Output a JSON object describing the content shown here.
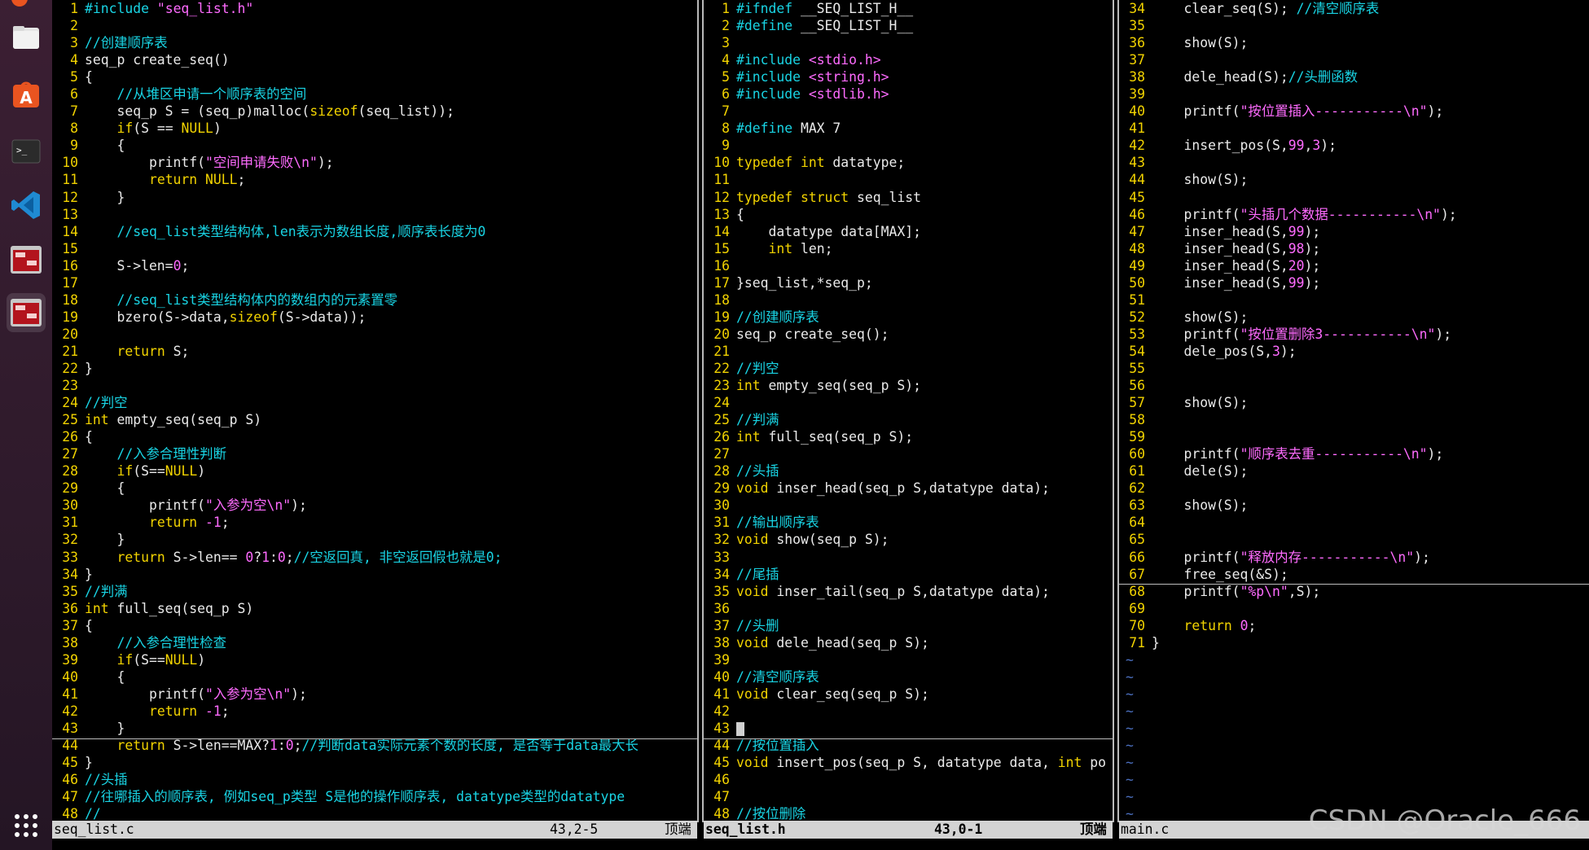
{
  "dock": {
    "items": [
      {
        "icon": "files-icon"
      },
      {
        "icon": "app-center-icon"
      },
      {
        "icon": "terminal-icon"
      },
      {
        "icon": "vscode-icon"
      },
      {
        "icon": "terminal-window-icon"
      },
      {
        "icon": "terminal-window-icon-active"
      }
    ],
    "apps_grid_icon": "apps-grid-icon"
  },
  "colors": {
    "comment": "#19d4e4",
    "keyword": "#f2d300",
    "string": "#ff6bff",
    "line_number": "#f2d300",
    "cursor_line": "#c8c8c8"
  },
  "panes": [
    {
      "file": "seq_list.c",
      "position": "43,2-5",
      "scroll": "顶端",
      "lines": [
        {
          "n": "1",
          "t": "#include \"seq_list.h\""
        },
        {
          "n": "2",
          "t": ""
        },
        {
          "n": "3",
          "t": "//创建顺序表"
        },
        {
          "n": "4",
          "t": "seq_p create_seq()"
        },
        {
          "n": "5",
          "t": "{"
        },
        {
          "n": "6",
          "t": "    //从堆区申请一个顺序表的空间"
        },
        {
          "n": "7",
          "t": "    seq_p S = (seq_p)malloc(sizeof(seq_list));"
        },
        {
          "n": "8",
          "t": "    if(S == NULL)"
        },
        {
          "n": "9",
          "t": "    {"
        },
        {
          "n": "10",
          "t": "        printf(\"空间申请失败\\n\");"
        },
        {
          "n": "11",
          "t": "        return NULL;"
        },
        {
          "n": "12",
          "t": "    }"
        },
        {
          "n": "13",
          "t": ""
        },
        {
          "n": "14",
          "t": "    //seq_list类型结构体,len表示为数组长度,顺序表长度为0"
        },
        {
          "n": "15",
          "t": ""
        },
        {
          "n": "16",
          "t": "    S->len=0;"
        },
        {
          "n": "17",
          "t": ""
        },
        {
          "n": "18",
          "t": "    //seq_list类型结构体内的数组内的元素置零"
        },
        {
          "n": "19",
          "t": "    bzero(S->data,sizeof(S->data));"
        },
        {
          "n": "20",
          "t": ""
        },
        {
          "n": "21",
          "t": "    return S;"
        },
        {
          "n": "22",
          "t": "}"
        },
        {
          "n": "23",
          "t": ""
        },
        {
          "n": "24",
          "t": "//判空"
        },
        {
          "n": "25",
          "t": "int empty_seq(seq_p S)"
        },
        {
          "n": "26",
          "t": "{"
        },
        {
          "n": "27",
          "t": "    //入参合理性判断"
        },
        {
          "n": "28",
          "t": "    if(S==NULL)"
        },
        {
          "n": "29",
          "t": "    {"
        },
        {
          "n": "30",
          "t": "        printf(\"入参为空\\n\");"
        },
        {
          "n": "31",
          "t": "        return -1;"
        },
        {
          "n": "32",
          "t": "    }"
        },
        {
          "n": "33",
          "t": "    return S->len== 0?1:0;//空返回真, 非空返回假也就是0;"
        },
        {
          "n": "34",
          "t": "}"
        },
        {
          "n": "35",
          "t": "//判满"
        },
        {
          "n": "36",
          "t": "int full_seq(seq_p S)"
        },
        {
          "n": "37",
          "t": "{"
        },
        {
          "n": "38",
          "t": "    //入参合理性检查"
        },
        {
          "n": "39",
          "t": "    if(S==NULL)"
        },
        {
          "n": "40",
          "t": "    {"
        },
        {
          "n": "41",
          "t": "        printf(\"入参为空\\n\");"
        },
        {
          "n": "42",
          "t": "        return -1;"
        },
        {
          "n": "43",
          "t": "    }"
        },
        {
          "n": "44",
          "t": "    return S->len==MAX?1:0;//判断data实际元素个数的长度, 是否等于data最大长"
        },
        {
          "n": "45",
          "t": "}"
        },
        {
          "n": "46",
          "t": "//头插"
        },
        {
          "n": "47",
          "t": "//往哪插入的顺序表, 例如seq_p类型 S是他的操作顺序表, datatype类型的datatype"
        },
        {
          "n": "48",
          "t": "//"
        }
      ]
    },
    {
      "file": "seq_list.h",
      "position": "43,0-1",
      "scroll": "顶端",
      "lines": [
        {
          "n": "1",
          "t": "#ifndef __SEQ_LIST_H__"
        },
        {
          "n": "2",
          "t": "#define __SEQ_LIST_H__"
        },
        {
          "n": "3",
          "t": ""
        },
        {
          "n": "4",
          "t": "#include <stdio.h>"
        },
        {
          "n": "5",
          "t": "#include <string.h>"
        },
        {
          "n": "6",
          "t": "#include <stdlib.h>"
        },
        {
          "n": "7",
          "t": ""
        },
        {
          "n": "8",
          "t": "#define MAX 7"
        },
        {
          "n": "9",
          "t": ""
        },
        {
          "n": "10",
          "t": "typedef int datatype;"
        },
        {
          "n": "11",
          "t": ""
        },
        {
          "n": "12",
          "t": "typedef struct seq_list"
        },
        {
          "n": "13",
          "t": "{"
        },
        {
          "n": "14",
          "t": "    datatype data[MAX];"
        },
        {
          "n": "15",
          "t": "    int len;"
        },
        {
          "n": "16",
          "t": ""
        },
        {
          "n": "17",
          "t": "}seq_list,*seq_p;"
        },
        {
          "n": "18",
          "t": ""
        },
        {
          "n": "19",
          "t": "//创建顺序表"
        },
        {
          "n": "20",
          "t": "seq_p create_seq();"
        },
        {
          "n": "21",
          "t": ""
        },
        {
          "n": "22",
          "t": "//判空"
        },
        {
          "n": "23",
          "t": "int empty_seq(seq_p S);"
        },
        {
          "n": "24",
          "t": ""
        },
        {
          "n": "25",
          "t": "//判满"
        },
        {
          "n": "26",
          "t": "int full_seq(seq_p S);"
        },
        {
          "n": "27",
          "t": ""
        },
        {
          "n": "28",
          "t": "//头插"
        },
        {
          "n": "29",
          "t": "void inser_head(seq_p S,datatype data);"
        },
        {
          "n": "30",
          "t": ""
        },
        {
          "n": "31",
          "t": "//输出顺序表"
        },
        {
          "n": "32",
          "t": "void show(seq_p S);"
        },
        {
          "n": "33",
          "t": ""
        },
        {
          "n": "34",
          "t": "//尾插"
        },
        {
          "n": "35",
          "t": "void inser_tail(seq_p S,datatype data);"
        },
        {
          "n": "36",
          "t": ""
        },
        {
          "n": "37",
          "t": "//头删"
        },
        {
          "n": "38",
          "t": "void dele_head(seq_p S);"
        },
        {
          "n": "39",
          "t": ""
        },
        {
          "n": "40",
          "t": "//清空顺序表"
        },
        {
          "n": "41",
          "t": "void clear_seq(seq_p S);"
        },
        {
          "n": "42",
          "t": ""
        },
        {
          "n": "43",
          "t": ""
        },
        {
          "n": "44",
          "t": "//按位置插入"
        },
        {
          "n": "45",
          "t": "void insert_pos(seq_p S, datatype data, int po"
        },
        {
          "n": "46",
          "t": ""
        },
        {
          "n": "47",
          "t": ""
        },
        {
          "n": "48",
          "t": "//按位删除"
        }
      ]
    },
    {
      "file": "main.c",
      "position": "",
      "scroll": "",
      "lines": [
        {
          "n": "34",
          "t": "    clear_seq(S); //清空顺序表"
        },
        {
          "n": "35",
          "t": ""
        },
        {
          "n": "36",
          "t": "    show(S);"
        },
        {
          "n": "37",
          "t": ""
        },
        {
          "n": "38",
          "t": "    dele_head(S);//头删函数"
        },
        {
          "n": "39",
          "t": ""
        },
        {
          "n": "40",
          "t": "    printf(\"按位置插入-----------\\n\");"
        },
        {
          "n": "41",
          "t": ""
        },
        {
          "n": "42",
          "t": "    insert_pos(S,99,3);"
        },
        {
          "n": "43",
          "t": ""
        },
        {
          "n": "44",
          "t": "    show(S);"
        },
        {
          "n": "45",
          "t": ""
        },
        {
          "n": "46",
          "t": "    printf(\"头插几个数据-----------\\n\");"
        },
        {
          "n": "47",
          "t": "    inser_head(S,99);"
        },
        {
          "n": "48",
          "t": "    inser_head(S,98);"
        },
        {
          "n": "49",
          "t": "    inser_head(S,20);"
        },
        {
          "n": "50",
          "t": "    inser_head(S,99);"
        },
        {
          "n": "51",
          "t": ""
        },
        {
          "n": "52",
          "t": "    show(S);"
        },
        {
          "n": "53",
          "t": "    printf(\"按位置删除3-----------\\n\");"
        },
        {
          "n": "54",
          "t": "    dele_pos(S,3);"
        },
        {
          "n": "55",
          "t": ""
        },
        {
          "n": "56",
          "t": ""
        },
        {
          "n": "57",
          "t": "    show(S);"
        },
        {
          "n": "58",
          "t": ""
        },
        {
          "n": "59",
          "t": ""
        },
        {
          "n": "60",
          "t": "    printf(\"顺序表去重-----------\\n\");"
        },
        {
          "n": "61",
          "t": "    dele(S);"
        },
        {
          "n": "62",
          "t": ""
        },
        {
          "n": "63",
          "t": "    show(S);"
        },
        {
          "n": "64",
          "t": ""
        },
        {
          "n": "65",
          "t": ""
        },
        {
          "n": "66",
          "t": "    printf(\"释放内存-----------\\n\");"
        },
        {
          "n": "67",
          "t": "    free_seq(&S);"
        },
        {
          "n": "68",
          "t": "    printf(\"%p\\n\",S);"
        },
        {
          "n": "69",
          "t": ""
        },
        {
          "n": "70",
          "t": "    return 0;"
        },
        {
          "n": "71",
          "t": "}"
        }
      ],
      "tilde_rows": 10
    }
  ],
  "watermark": "CSDN @Oracle_666"
}
